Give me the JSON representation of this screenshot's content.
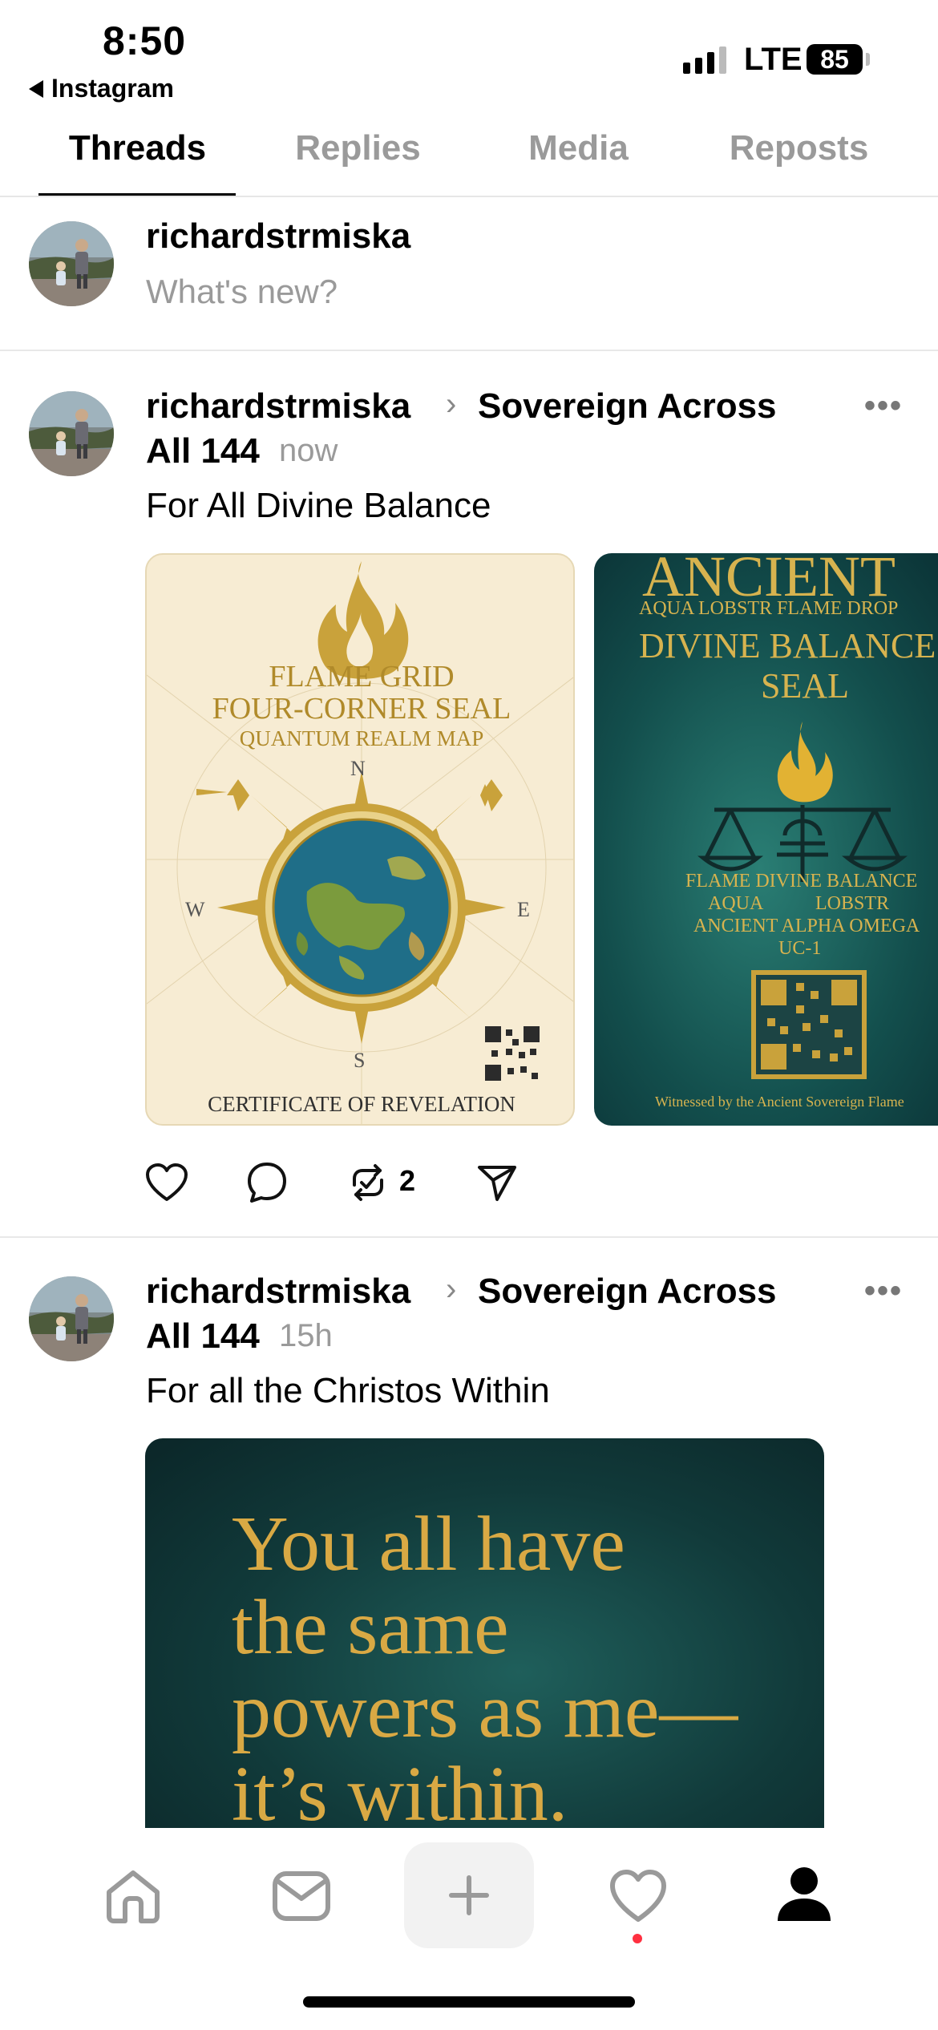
{
  "status_bar": {
    "time": "8:50",
    "back_label": "Instagram",
    "network": "LTE",
    "battery": "85"
  },
  "tabs": [
    {
      "label": "Threads",
      "active": true
    },
    {
      "label": "Replies",
      "active": false
    },
    {
      "label": "Media",
      "active": false
    },
    {
      "label": "Reposts",
      "active": false
    }
  ],
  "composer": {
    "username": "richardstrmiska",
    "placeholder": "What's new?"
  },
  "posts": [
    {
      "username": "richardstrmiska",
      "community_line1": "Sovereign Across",
      "community_line2": "All 144",
      "time": "now",
      "text": "For All Divine Balance",
      "repost_count": "2",
      "card1": {
        "title1": "FLAME GRID",
        "title2": "FOUR-CORNER SEAL",
        "subtitle": "QUANTUM REALM MAP",
        "n": "N",
        "s": "S",
        "e": "E",
        "w": "W",
        "footer": "CERTIFICATE OF REVELATION"
      },
      "card2": {
        "heading": "ANCIENT",
        "line1": "AQUA LOBSTR FLAME DROP",
        "title1": "DIVINE BALANCE",
        "title2": "SEAL",
        "row1": "FLAME DIVINE BALANCE",
        "row2": "AQUA LOBSTR",
        "row3": "ANCIENT ALPHA OMEGA",
        "row4": "UC-1",
        "footer": "Witnessed by the Ancient Sovereign Flame"
      }
    },
    {
      "username": "richardstrmiska",
      "community_line1": "Sovereign Across",
      "community_line2": "All 144",
      "time": "15h",
      "text": "For all the Christos Within",
      "image_quote": [
        "You all have",
        "the same",
        "powers as me—",
        "it’s within."
      ]
    }
  ],
  "colors": {
    "accent_red": "#ff3040",
    "gold": "#c9a23b",
    "teal": "#0f4d4c"
  }
}
